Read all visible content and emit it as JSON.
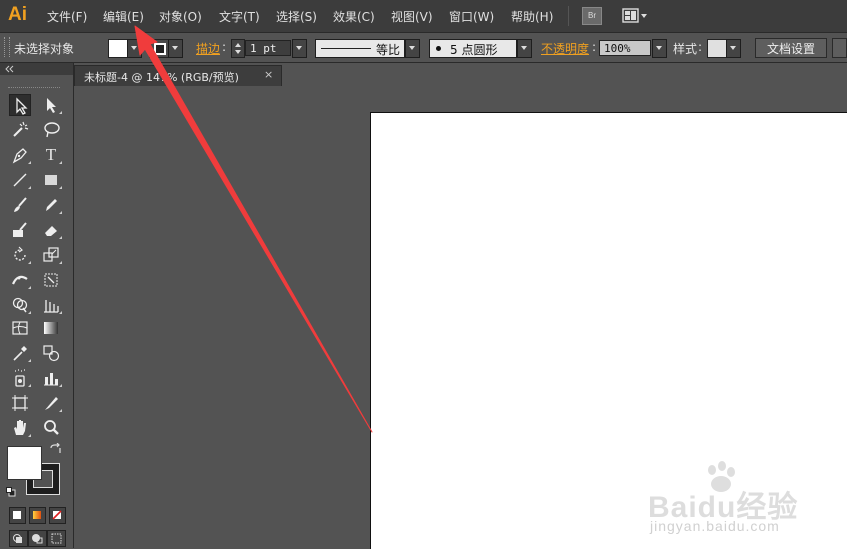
{
  "app": {
    "logo": "Ai"
  },
  "menu": {
    "items": [
      "文件(F)",
      "编辑(E)",
      "对象(O)",
      "文字(T)",
      "选择(S)",
      "效果(C)",
      "视图(V)",
      "窗口(W)",
      "帮助(H)"
    ],
    "bridge_label": "Br"
  },
  "control_bar": {
    "selection_status": "未选择对象",
    "stroke_label": "描边",
    "stroke_weight": "1 pt",
    "profile_label": "等比",
    "brush_label": "5 点圆形",
    "opacity_label": "不透明度",
    "opacity_value": "100%",
    "style_label": "样式",
    "doc_settings_button": "文档设置"
  },
  "document": {
    "tab_title": "未标题-4 @ 147% (RGB/预览)",
    "tab_close": "×"
  },
  "colors": {
    "accent_orange": "#f0a020",
    "annotation_arrow": "#f03c3c",
    "artboard": "#ffffff",
    "ui_dark": "#3c3c3c",
    "ui_mid": "#535353"
  },
  "watermark": {
    "brand": "Baidu经验",
    "url": "jingyan.baidu.com"
  }
}
